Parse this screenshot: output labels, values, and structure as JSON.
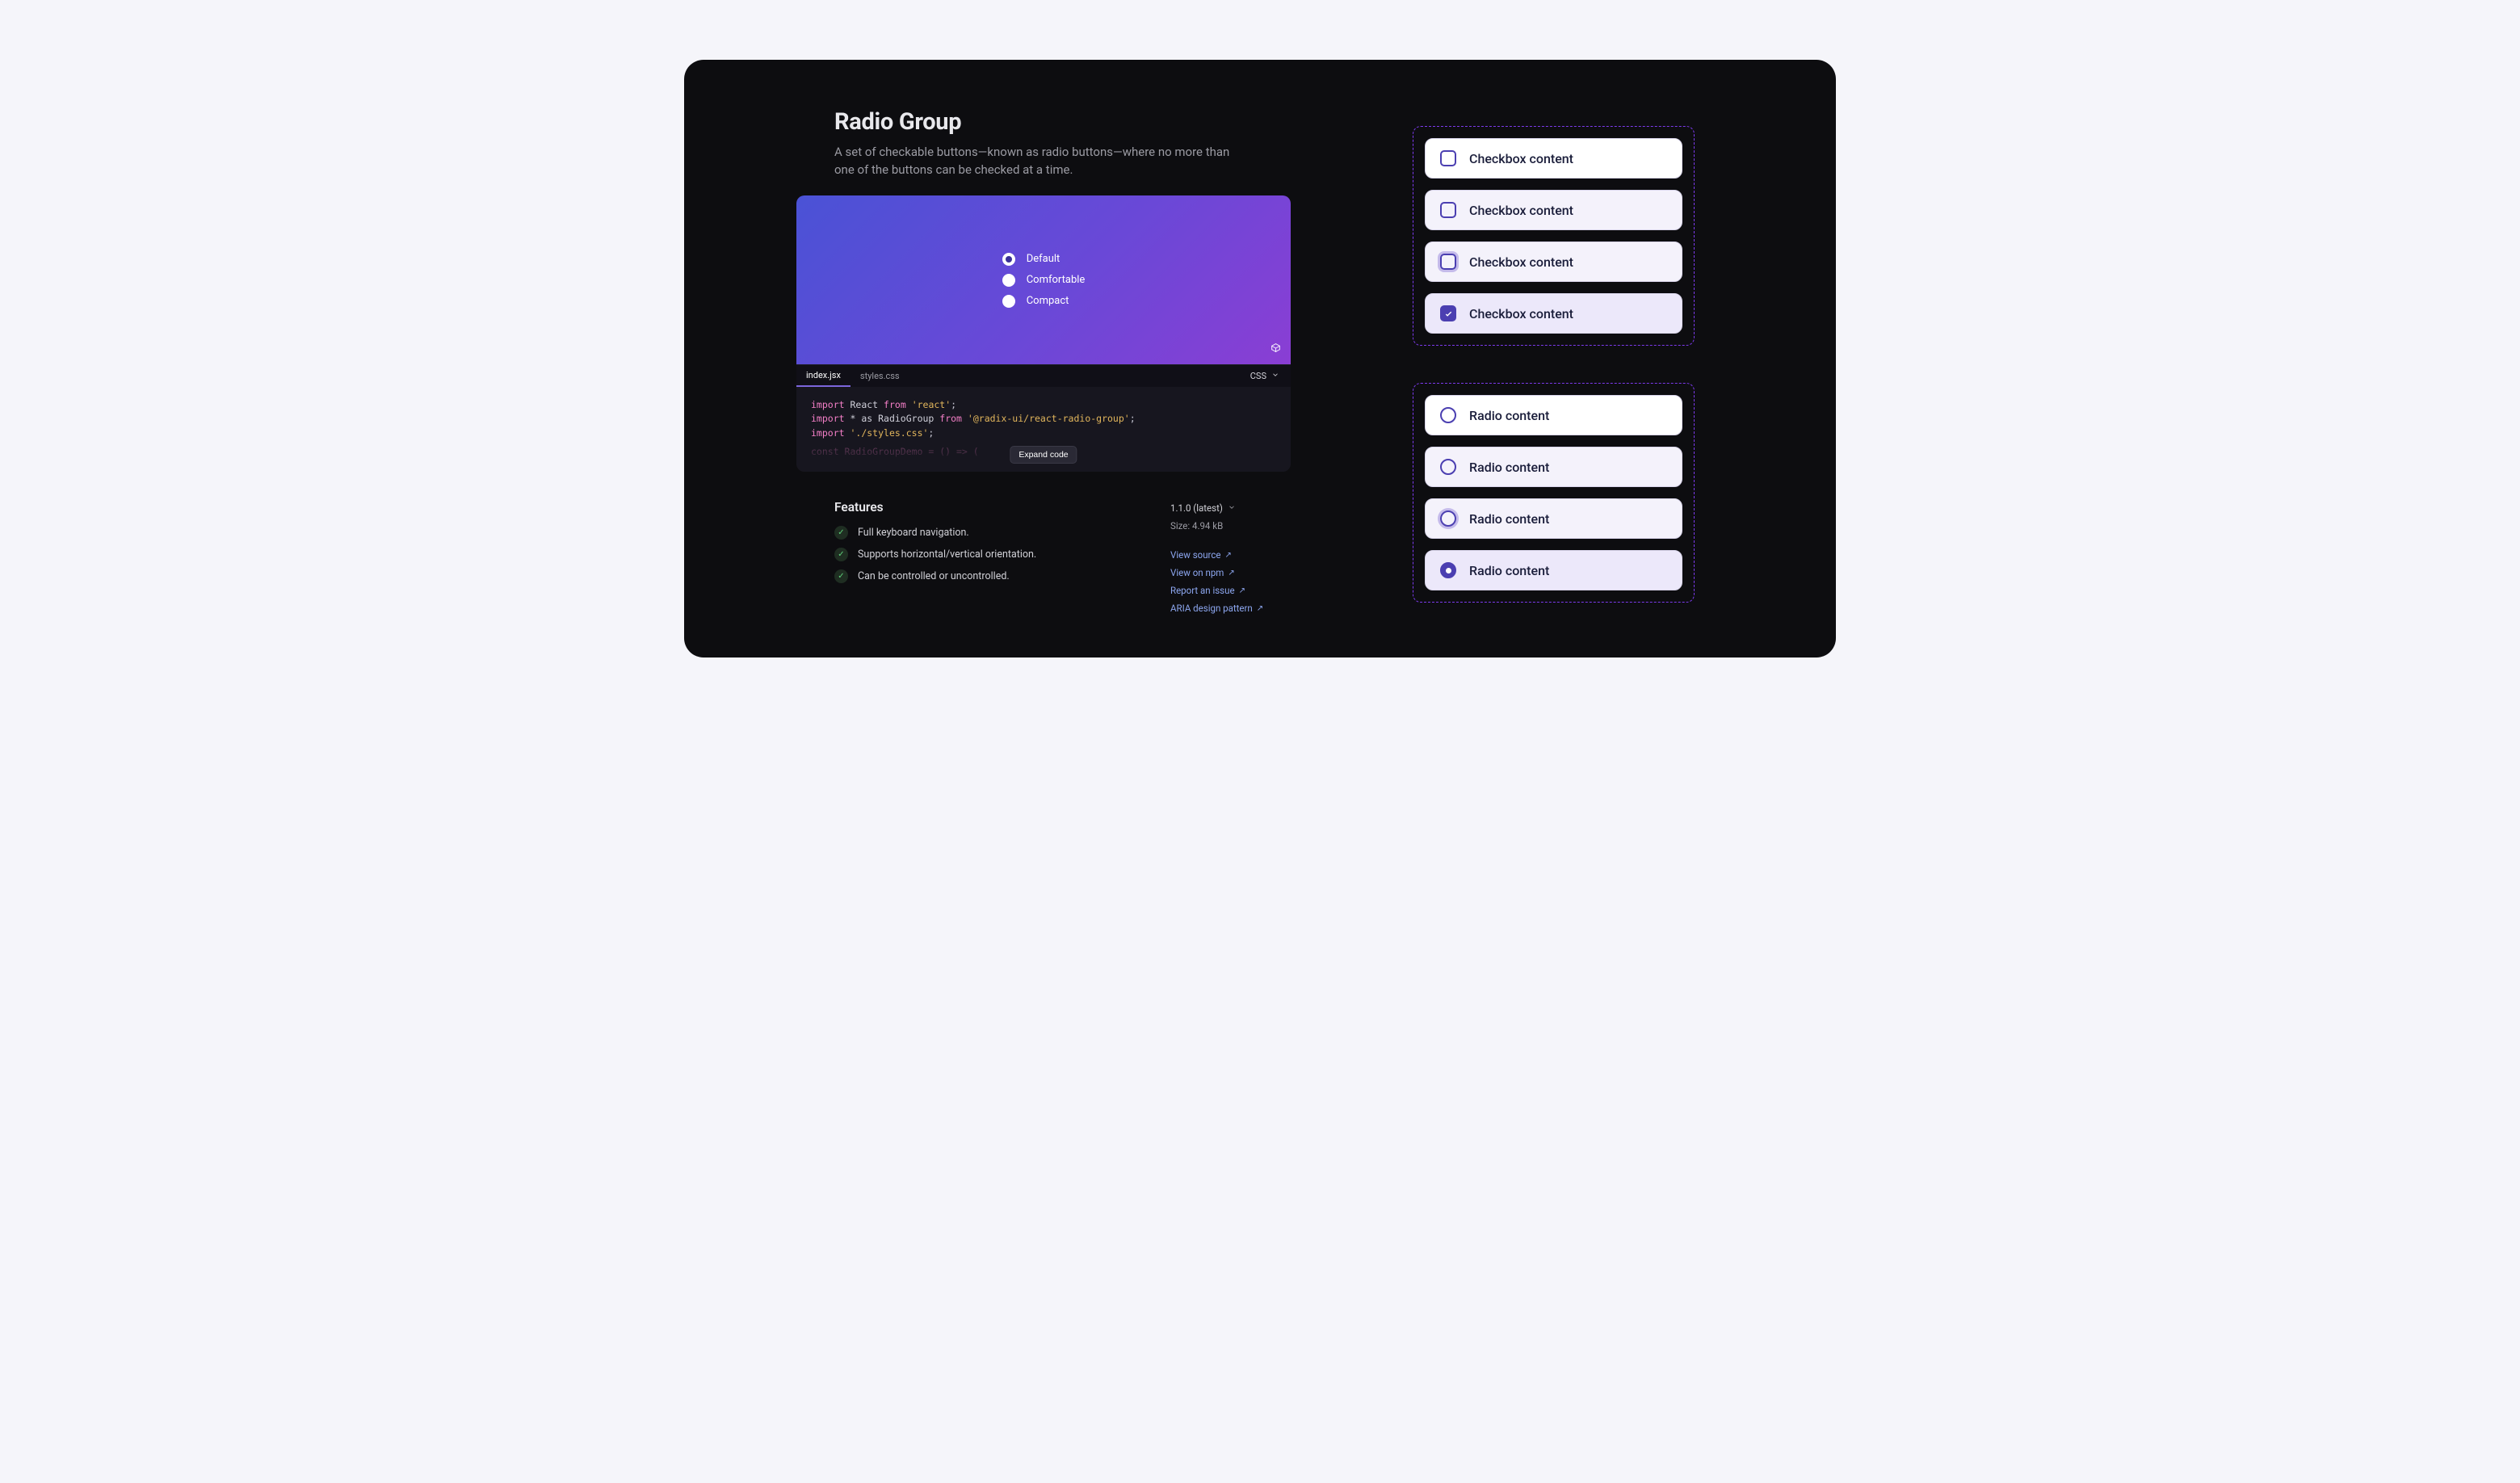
{
  "docs": {
    "title": "Radio Group",
    "subtitle": "A set of checkable buttons—known as radio buttons—where no more than one of the buttons can be checked at a time.",
    "hero_options": [
      {
        "label": "Default",
        "selected": true
      },
      {
        "label": "Comfortable",
        "selected": false
      },
      {
        "label": "Compact",
        "selected": false
      }
    ],
    "code_tabs": {
      "tabs": [
        "index.jsx",
        "styles.css"
      ],
      "active": "index.jsx",
      "lang_label": "CSS"
    },
    "code": {
      "line1_kw1": "import",
      "line1_id": "React",
      "line1_kw2": "from",
      "line1_str": "'react'",
      "line1_end": ";",
      "line2_kw1": "import",
      "line2_id": "* as RadioGroup",
      "line2_kw2": "from",
      "line2_str": "'@radix-ui/react-radio-group'",
      "line2_end": ";",
      "line3_kw1": "import",
      "line3_str": "'./styles.css'",
      "line3_end": ";",
      "line4": "const RadioGroupDemo = () => (",
      "expand_label": "Expand code"
    },
    "features_heading": "Features",
    "features": [
      "Full keyboard navigation.",
      "Supports horizontal/vertical orientation.",
      "Can be controlled or uncontrolled."
    ],
    "meta": {
      "version_label": "1.1.0 (latest)",
      "size_label": "Size: 4.94 kB",
      "links": [
        "View source",
        "View on npm",
        "Report an issue",
        "ARIA design pattern"
      ]
    }
  },
  "preview": {
    "checkbox_label": "Checkbox content",
    "radio_label": "Radio content",
    "checkbox_states": [
      "default",
      "hover",
      "focus",
      "checked"
    ],
    "radio_states": [
      "default",
      "hover",
      "focus",
      "checked"
    ]
  }
}
